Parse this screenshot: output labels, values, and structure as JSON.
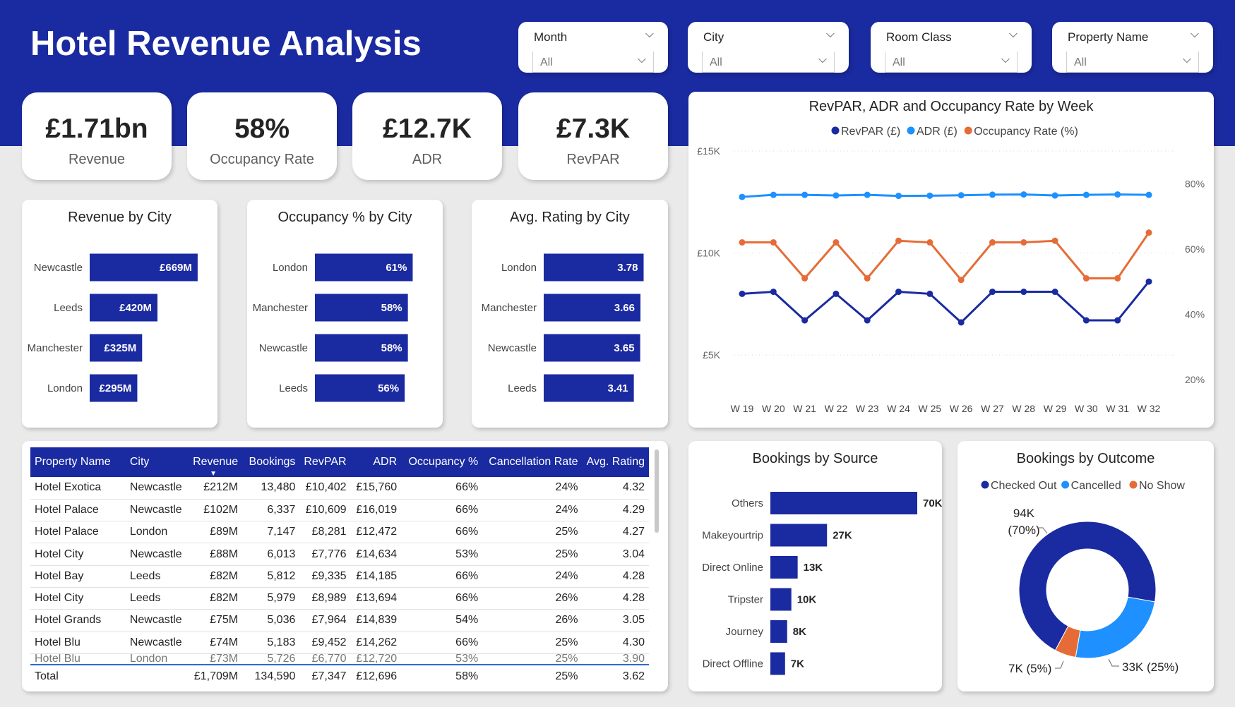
{
  "header": {
    "title": "Hotel Revenue Analysis"
  },
  "slicers": [
    {
      "title": "Month",
      "value": "All"
    },
    {
      "title": "City",
      "value": "All"
    },
    {
      "title": "Room Class",
      "value": "All"
    },
    {
      "title": "Property Name",
      "value": "All"
    }
  ],
  "kpis": [
    {
      "value": "£1.71bn",
      "label": "Revenue"
    },
    {
      "value": "58%",
      "label": "Occupancy Rate"
    },
    {
      "value": "£12.7K",
      "label": "ADR"
    },
    {
      "value": "£7.3K",
      "label": "RevPAR"
    }
  ],
  "colors": {
    "navy": "#1a2aa0",
    "blue": "#1e90ff",
    "orange": "#e66c37",
    "bar": "#1a2aa0"
  },
  "chart_data": [
    {
      "type": "bar",
      "orientation": "horizontal",
      "title": "Revenue by City",
      "categories": [
        "Newcastle",
        "Leeds",
        "Manchester",
        "London"
      ],
      "values": [
        669,
        420,
        325,
        295
      ],
      "labels": [
        "£669M",
        "£420M",
        "£325M",
        "£295M"
      ]
    },
    {
      "type": "bar",
      "orientation": "horizontal",
      "title": "Occupancy % by City",
      "categories": [
        "London",
        "Manchester",
        "Newcastle",
        "Leeds"
      ],
      "values": [
        61,
        58,
        58,
        56
      ],
      "labels": [
        "61%",
        "58%",
        "58%",
        "56%"
      ]
    },
    {
      "type": "bar",
      "orientation": "horizontal",
      "title": "Avg. Rating by City",
      "categories": [
        "London",
        "Manchester",
        "Newcastle",
        "Leeds"
      ],
      "values": [
        3.78,
        3.66,
        3.65,
        3.41
      ],
      "labels": [
        "3.78",
        "3.66",
        "3.65",
        "3.41"
      ]
    },
    {
      "type": "line",
      "title": "RevPAR, ADR and Occupancy Rate by Week",
      "x": [
        "W 19",
        "W 20",
        "W 21",
        "W 22",
        "W 23",
        "W 24",
        "W 25",
        "W 26",
        "W 27",
        "W 28",
        "W 29",
        "W 30",
        "W 31",
        "W 32"
      ],
      "y_left_ticks": [
        "£5K",
        "£10K",
        "£15K"
      ],
      "y_left_range": [
        3000,
        15000
      ],
      "y_right_ticks": [
        "20%",
        "40%",
        "60%",
        "80%"
      ],
      "y_right_range": [
        15,
        90
      ],
      "series": [
        {
          "name": "RevPAR (£)",
          "axis": "left",
          "color": "#1a2aa0",
          "values": [
            8000,
            8100,
            6700,
            8000,
            6700,
            8100,
            8000,
            6600,
            8100,
            8100,
            8100,
            6700,
            6700,
            8600
          ]
        },
        {
          "name": "ADR (£)",
          "axis": "left",
          "color": "#1e90ff",
          "values": [
            12750,
            12850,
            12850,
            12820,
            12850,
            12800,
            12810,
            12830,
            12860,
            12870,
            12820,
            12850,
            12870,
            12850
          ]
        },
        {
          "name": "Occupancy Rate (%)",
          "axis": "right",
          "color": "#e66c37",
          "values": [
            62,
            62,
            51,
            62,
            51,
            62.5,
            62,
            50.5,
            62,
            62,
            62.5,
            51,
            51,
            65
          ]
        }
      ],
      "legend": "top-center",
      "grid": true
    },
    {
      "type": "bar",
      "orientation": "horizontal",
      "title": "Bookings by Source",
      "categories": [
        "Others",
        "Makeyourtrip",
        "Direct Online",
        "Tripster",
        "Journey",
        "Direct Offline"
      ],
      "values": [
        70,
        27,
        13,
        10,
        8,
        7
      ],
      "labels": [
        "70K",
        "27K",
        "13K",
        "10K",
        "8K",
        "7K"
      ]
    },
    {
      "type": "pie",
      "donut": true,
      "title": "Bookings by Outcome",
      "categories": [
        "Checked Out",
        "Cancelled",
        "No Show"
      ],
      "values": [
        70,
        25,
        5
      ],
      "colors": [
        "#1a2aa0",
        "#1e90ff",
        "#e66c37"
      ],
      "labels": [
        {
          "line1": "94K",
          "line2": "(70%)"
        },
        {
          "line1": "33K (25%)",
          "line2": ""
        },
        {
          "line1": "7K (5%)",
          "line2": ""
        }
      ],
      "legend": "top-center"
    }
  ],
  "table": {
    "columns": [
      "Property Name",
      "City",
      "Revenue",
      "Bookings",
      "RevPAR",
      "ADR",
      "Occupancy %",
      "Cancellation Rate",
      "Avg. Rating"
    ],
    "sort_indicator": "▼",
    "rows": [
      [
        "Hotel Exotica",
        "Newcastle",
        "£212M",
        "13,480",
        "£10,402",
        "£15,760",
        "66%",
        "24%",
        "4.32"
      ],
      [
        "Hotel Palace",
        "Newcastle",
        "£102M",
        "6,337",
        "£10,609",
        "£16,019",
        "66%",
        "24%",
        "4.29"
      ],
      [
        "Hotel Palace",
        "London",
        "£89M",
        "7,147",
        "£8,281",
        "£12,472",
        "66%",
        "25%",
        "4.27"
      ],
      [
        "Hotel City",
        "Newcastle",
        "£88M",
        "6,013",
        "£7,776",
        "£14,634",
        "53%",
        "25%",
        "3.04"
      ],
      [
        "Hotel Bay",
        "Leeds",
        "£82M",
        "5,812",
        "£9,335",
        "£14,185",
        "66%",
        "24%",
        "4.28"
      ],
      [
        "Hotel City",
        "Leeds",
        "£82M",
        "5,979",
        "£8,989",
        "£13,694",
        "66%",
        "26%",
        "4.28"
      ],
      [
        "Hotel Grands",
        "Newcastle",
        "£75M",
        "5,036",
        "£7,964",
        "£14,839",
        "54%",
        "26%",
        "3.05"
      ],
      [
        "Hotel Blu",
        "Newcastle",
        "£74M",
        "5,183",
        "£9,452",
        "£14,262",
        "66%",
        "25%",
        "4.30"
      ],
      [
        "Hotel Blu",
        "London",
        "£73M",
        "5,726",
        "£6,770",
        "£12,720",
        "53%",
        "25%",
        "3.90"
      ]
    ],
    "total": [
      "Total",
      "",
      "£1,709M",
      "134,590",
      "£7,347",
      "£12,696",
      "58%",
      "25%",
      "3.62"
    ]
  }
}
